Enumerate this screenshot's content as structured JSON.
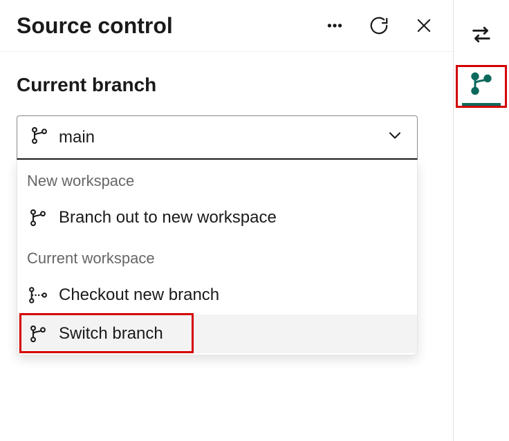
{
  "header": {
    "title": "Source control"
  },
  "section": {
    "label": "Current branch"
  },
  "branchSelect": {
    "value": "main"
  },
  "dropdown": {
    "groups": [
      {
        "label": "New workspace",
        "items": [
          {
            "label": "Branch out to new workspace",
            "icon": "branch-icon"
          }
        ]
      },
      {
        "label": "Current workspace",
        "items": [
          {
            "label": "Checkout new branch",
            "icon": "checkout-icon"
          },
          {
            "label": "Switch branch",
            "icon": "switch-branch-icon",
            "selected": true,
            "highlight": true
          }
        ]
      }
    ]
  },
  "colors": {
    "highlight": "#d40000",
    "accent": "#0c695d"
  }
}
